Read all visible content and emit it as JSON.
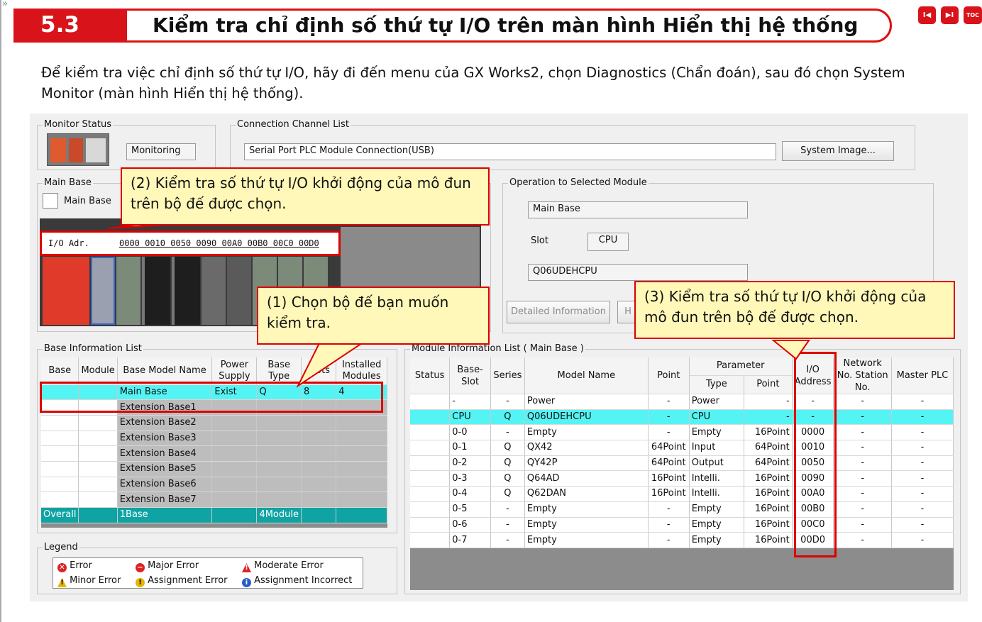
{
  "header": {
    "section_number": "5.3",
    "title": "Kiểm tra chỉ định số thứ tự I/O trên màn hình Hiển thị hệ thống",
    "nav_buttons": [
      "I◀",
      "▶I",
      "TOC"
    ]
  },
  "intro_text": "Để kiểm tra việc chỉ định số thứ tự I/O, hãy đi đến menu của GX Works2, chọn Diagnostics (Chẩn đoán), sau đó chọn System Monitor (màn hình Hiển thị hệ thống).",
  "monitor_status": {
    "title": "Monitor Status",
    "status": "Monitoring"
  },
  "connection": {
    "title": "Connection Channel List",
    "value": "Serial Port  PLC Module Connection(USB)",
    "button": "System Image..."
  },
  "main_base": {
    "title": "Main Base",
    "label": "Main Base",
    "io_label": "I/O Adr.",
    "io_values": "0000 0010 0050 0090 00A0 00B0 00C0 00D0"
  },
  "operation": {
    "title": "Operation to Selected Module",
    "base": "Main Base",
    "slot_label": "Slot",
    "slot_value": "CPU",
    "model": "Q06UDEHCPU",
    "detail_button": "Detailed Information",
    "other_button": "H"
  },
  "callouts": {
    "c1": "(1) Chọn bộ đế bạn muốn kiểm tra.",
    "c2": "(2) Kiểm tra số thứ tự I/O khởi động của mô đun trên bộ đế được chọn.",
    "c3": "(3) Kiểm tra số thứ tự I/O khởi động của mô đun trên bộ đế được chọn."
  },
  "base_info": {
    "title": "Base Information List",
    "headers": [
      "Base",
      "Module",
      "Base Model Name",
      "Power Supply",
      "Base Type",
      "Slots",
      "Installed Modules"
    ],
    "rows": [
      [
        "",
        "",
        "Main Base",
        "Exist",
        "Q",
        "8",
        "4"
      ],
      [
        "",
        "",
        "Extension Base1",
        "",
        "",
        "",
        ""
      ],
      [
        "",
        "",
        "Extension Base2",
        "",
        "",
        "",
        ""
      ],
      [
        "",
        "",
        "Extension Base3",
        "",
        "",
        "",
        ""
      ],
      [
        "",
        "",
        "Extension Base4",
        "",
        "",
        "",
        ""
      ],
      [
        "",
        "",
        "Extension Base5",
        "",
        "",
        "",
        ""
      ],
      [
        "",
        "",
        "Extension Base6",
        "",
        "",
        "",
        ""
      ],
      [
        "",
        "",
        "Extension Base7",
        "",
        "",
        "",
        ""
      ]
    ],
    "overall": [
      "Overall",
      "",
      "1Base",
      "",
      "4Module",
      "",
      ""
    ]
  },
  "module_info": {
    "title": "Module Information List ( Main Base )",
    "headers": {
      "status": "Status",
      "base_slot": "Base-Slot",
      "series": "Series",
      "model": "Model Name",
      "point": "Point",
      "parameter": "Parameter",
      "type": "Type",
      "ppoint": "Point",
      "io": "I/O Address",
      "network": "Network No. Station No.",
      "master": "Master PLC"
    },
    "rows": [
      [
        "",
        "-",
        "-",
        "Power",
        "-",
        "Power",
        "-",
        "-",
        "-",
        "-"
      ],
      [
        "",
        "CPU",
        "Q",
        "Q06UDEHCPU",
        "-",
        "CPU",
        "-",
        "-",
        "-",
        "-"
      ],
      [
        "",
        "0-0",
        "-",
        "Empty",
        "-",
        "Empty",
        "16Point",
        "0000",
        "-",
        "-"
      ],
      [
        "",
        "0-1",
        "Q",
        "QX42",
        "64Point",
        "Input",
        "64Point",
        "0010",
        "-",
        "-"
      ],
      [
        "",
        "0-2",
        "Q",
        "QY42P",
        "64Point",
        "Output",
        "64Point",
        "0050",
        "-",
        "-"
      ],
      [
        "",
        "0-3",
        "Q",
        "Q64AD",
        "16Point",
        "Intelli.",
        "16Point",
        "0090",
        "-",
        "-"
      ],
      [
        "",
        "0-4",
        "Q",
        "Q62DAN",
        "16Point",
        "Intelli.",
        "16Point",
        "00A0",
        "-",
        "-"
      ],
      [
        "",
        "0-5",
        "-",
        "Empty",
        "-",
        "Empty",
        "16Point",
        "00B0",
        "-",
        "-"
      ],
      [
        "",
        "0-6",
        "-",
        "Empty",
        "-",
        "Empty",
        "16Point",
        "00C0",
        "-",
        "-"
      ],
      [
        "",
        "0-7",
        "-",
        "Empty",
        "-",
        "Empty",
        "16Point",
        "00D0",
        "-",
        "-"
      ]
    ]
  },
  "legend": {
    "title": "Legend",
    "items": [
      "Error",
      "Major Error",
      "Moderate Error",
      "Minor Error",
      "Assignment Error",
      "Assignment Incorrect"
    ]
  },
  "colors": {
    "accent_red": "#d8141a",
    "selected_row": "#55f4f4",
    "overall_row": "#0fa3a3",
    "callout_bg": "#fff8b8"
  }
}
